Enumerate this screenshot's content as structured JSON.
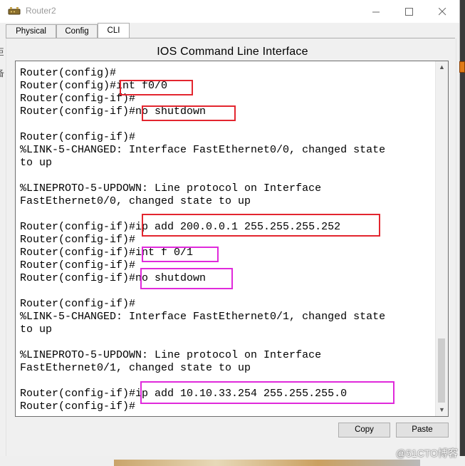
{
  "window": {
    "title": "Router2"
  },
  "tabs": [
    {
      "label": "Physical"
    },
    {
      "label": "Config"
    },
    {
      "label": "CLI"
    }
  ],
  "cli": {
    "heading": "IOS Command Line Interface",
    "lines": [
      "Router(config)#",
      "Router(config)#int f0/0",
      "Router(config-if)#",
      "Router(config-if)#no shutdown",
      "",
      "Router(config-if)#",
      "%LINK-5-CHANGED: Interface FastEthernet0/0, changed state",
      "to up",
      "",
      "%LINEPROTO-5-UPDOWN: Line protocol on Interface",
      "FastEthernet0/0, changed state to up",
      "",
      "Router(config-if)#ip add 200.0.0.1 255.255.255.252",
      "Router(config-if)#",
      "Router(config-if)#int f 0/1",
      "Router(config-if)#",
      "Router(config-if)#no shutdown",
      "",
      "Router(config-if)#",
      "%LINK-5-CHANGED: Interface FastEthernet0/1, changed state",
      "to up",
      "",
      "%LINEPROTO-5-UPDOWN: Line protocol on Interface",
      "FastEthernet0/1, changed state to up",
      "",
      "Router(config-if)#ip add 10.10.33.254 255.255.255.0",
      "Router(config-if)#"
    ]
  },
  "buttons": {
    "copy": "Copy",
    "paste": "Paste"
  },
  "left_fragment": "巨\n备",
  "watermark": "@51CTO博客",
  "colors": {
    "highlight_red": "#e3262f",
    "highlight_magenta": "#e02adb"
  },
  "icons": {
    "app": "router-icon",
    "minimize": "minimize-icon",
    "maximize": "maximize-icon",
    "close": "close-icon",
    "scroll_up": "scroll-up-icon",
    "scroll_down": "scroll-down-icon"
  }
}
